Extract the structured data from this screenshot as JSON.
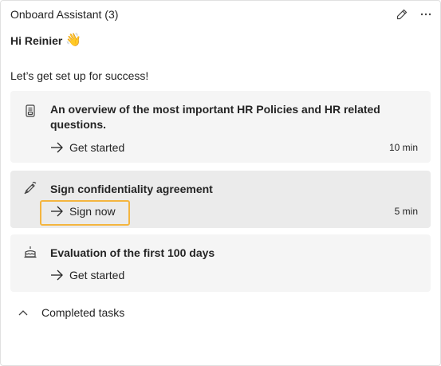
{
  "header": {
    "title": "Onboard Assistant (3)"
  },
  "greeting": {
    "text": "Hi Reinier",
    "emoji": "👋"
  },
  "subtitle": "Let’s get set up for success!",
  "tasks": [
    {
      "title": "An overview of the most important HR Policies and HR related questions.",
      "action": "Get started",
      "duration": "10 min",
      "icon": "document-policy-icon"
    },
    {
      "title": "Sign confidentiality agreement",
      "action": "Sign now",
      "duration": "5 min",
      "icon": "signature-pen-icon"
    },
    {
      "title": "Evaluation of the first 100 days",
      "action": "Get started",
      "duration": "",
      "icon": "cake-icon"
    }
  ],
  "completed": {
    "label": "Completed tasks"
  },
  "colors": {
    "highlight": "#f4b53f",
    "card_bg": "#f5f5f5",
    "active_card_bg": "#ebebeb"
  }
}
